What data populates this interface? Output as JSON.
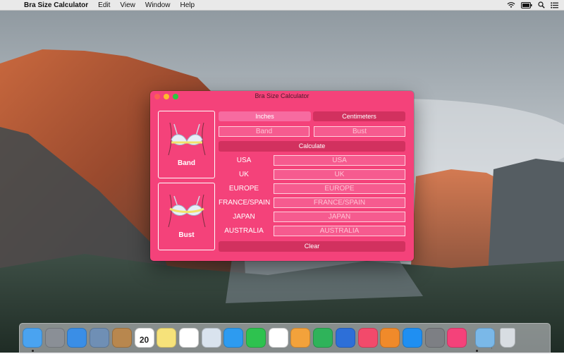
{
  "menubar": {
    "apple_glyph": "",
    "app_name": "Bra Size Calculator",
    "menus": [
      "Edit",
      "View",
      "Window",
      "Help"
    ],
    "status_icons": [
      "wifi-icon",
      "battery-icon",
      "search-icon",
      "list-icon"
    ]
  },
  "window": {
    "title": "Bra Size Calculator",
    "images": {
      "band_label": "Band",
      "bust_label": "Bust"
    },
    "units": {
      "inches_label": "Inches",
      "centimeters_label": "Centimeters",
      "selected": "Centimeters"
    },
    "inputs": {
      "band_placeholder": "Band",
      "bust_placeholder": "Bust"
    },
    "calculate_label": "Calculate",
    "clear_label": "Clear",
    "regions": [
      {
        "label": "USA",
        "placeholder": "USA"
      },
      {
        "label": "UK",
        "placeholder": "UK"
      },
      {
        "label": "EUROPE",
        "placeholder": "EUROPE"
      },
      {
        "label": "FRANCE/SPAIN",
        "placeholder": "FRANCE/SPAIN"
      },
      {
        "label": "JAPAN",
        "placeholder": "JAPAN"
      },
      {
        "label": "AUSTRALIA",
        "placeholder": "AUSTRALIA"
      }
    ]
  },
  "dock": {
    "calendar_day": "20",
    "apps": [
      {
        "name": "finder-icon",
        "color": "#4aa3f0"
      },
      {
        "name": "launchpad-icon",
        "color": "#8a8f96"
      },
      {
        "name": "safari-icon",
        "color": "#3a8ee6"
      },
      {
        "name": "preview-icon",
        "color": "#6f8fb5"
      },
      {
        "name": "contacts-icon",
        "color": "#b8874e"
      },
      {
        "name": "calendar-icon",
        "color": "#ffffff"
      },
      {
        "name": "notes-icon",
        "color": "#f6e27a"
      },
      {
        "name": "reminders-icon",
        "color": "#ffffff"
      },
      {
        "name": "photo-booth-icon",
        "color": "#d9e3ee"
      },
      {
        "name": "messages-icon",
        "color": "#2d9bf0"
      },
      {
        "name": "facetime-icon",
        "color": "#2ec24f"
      },
      {
        "name": "photos-icon",
        "color": "#ffffff"
      },
      {
        "name": "pages-icon",
        "color": "#f3a23b"
      },
      {
        "name": "numbers-icon",
        "color": "#2fb35a"
      },
      {
        "name": "keynote-icon",
        "color": "#2d6fd8"
      },
      {
        "name": "itunes-icon",
        "color": "#f24a6b"
      },
      {
        "name": "ibooks-icon",
        "color": "#f08a2a"
      },
      {
        "name": "app-store-icon",
        "color": "#1f8ff2"
      },
      {
        "name": "system-preferences-icon",
        "color": "#7d7f84"
      },
      {
        "name": "bra-size-calculator-icon",
        "color": "#f4427a"
      },
      {
        "name": "downloads-folder-icon",
        "color": "#7ab8e8"
      },
      {
        "name": "trash-icon",
        "color": "#d8dde2"
      }
    ]
  }
}
